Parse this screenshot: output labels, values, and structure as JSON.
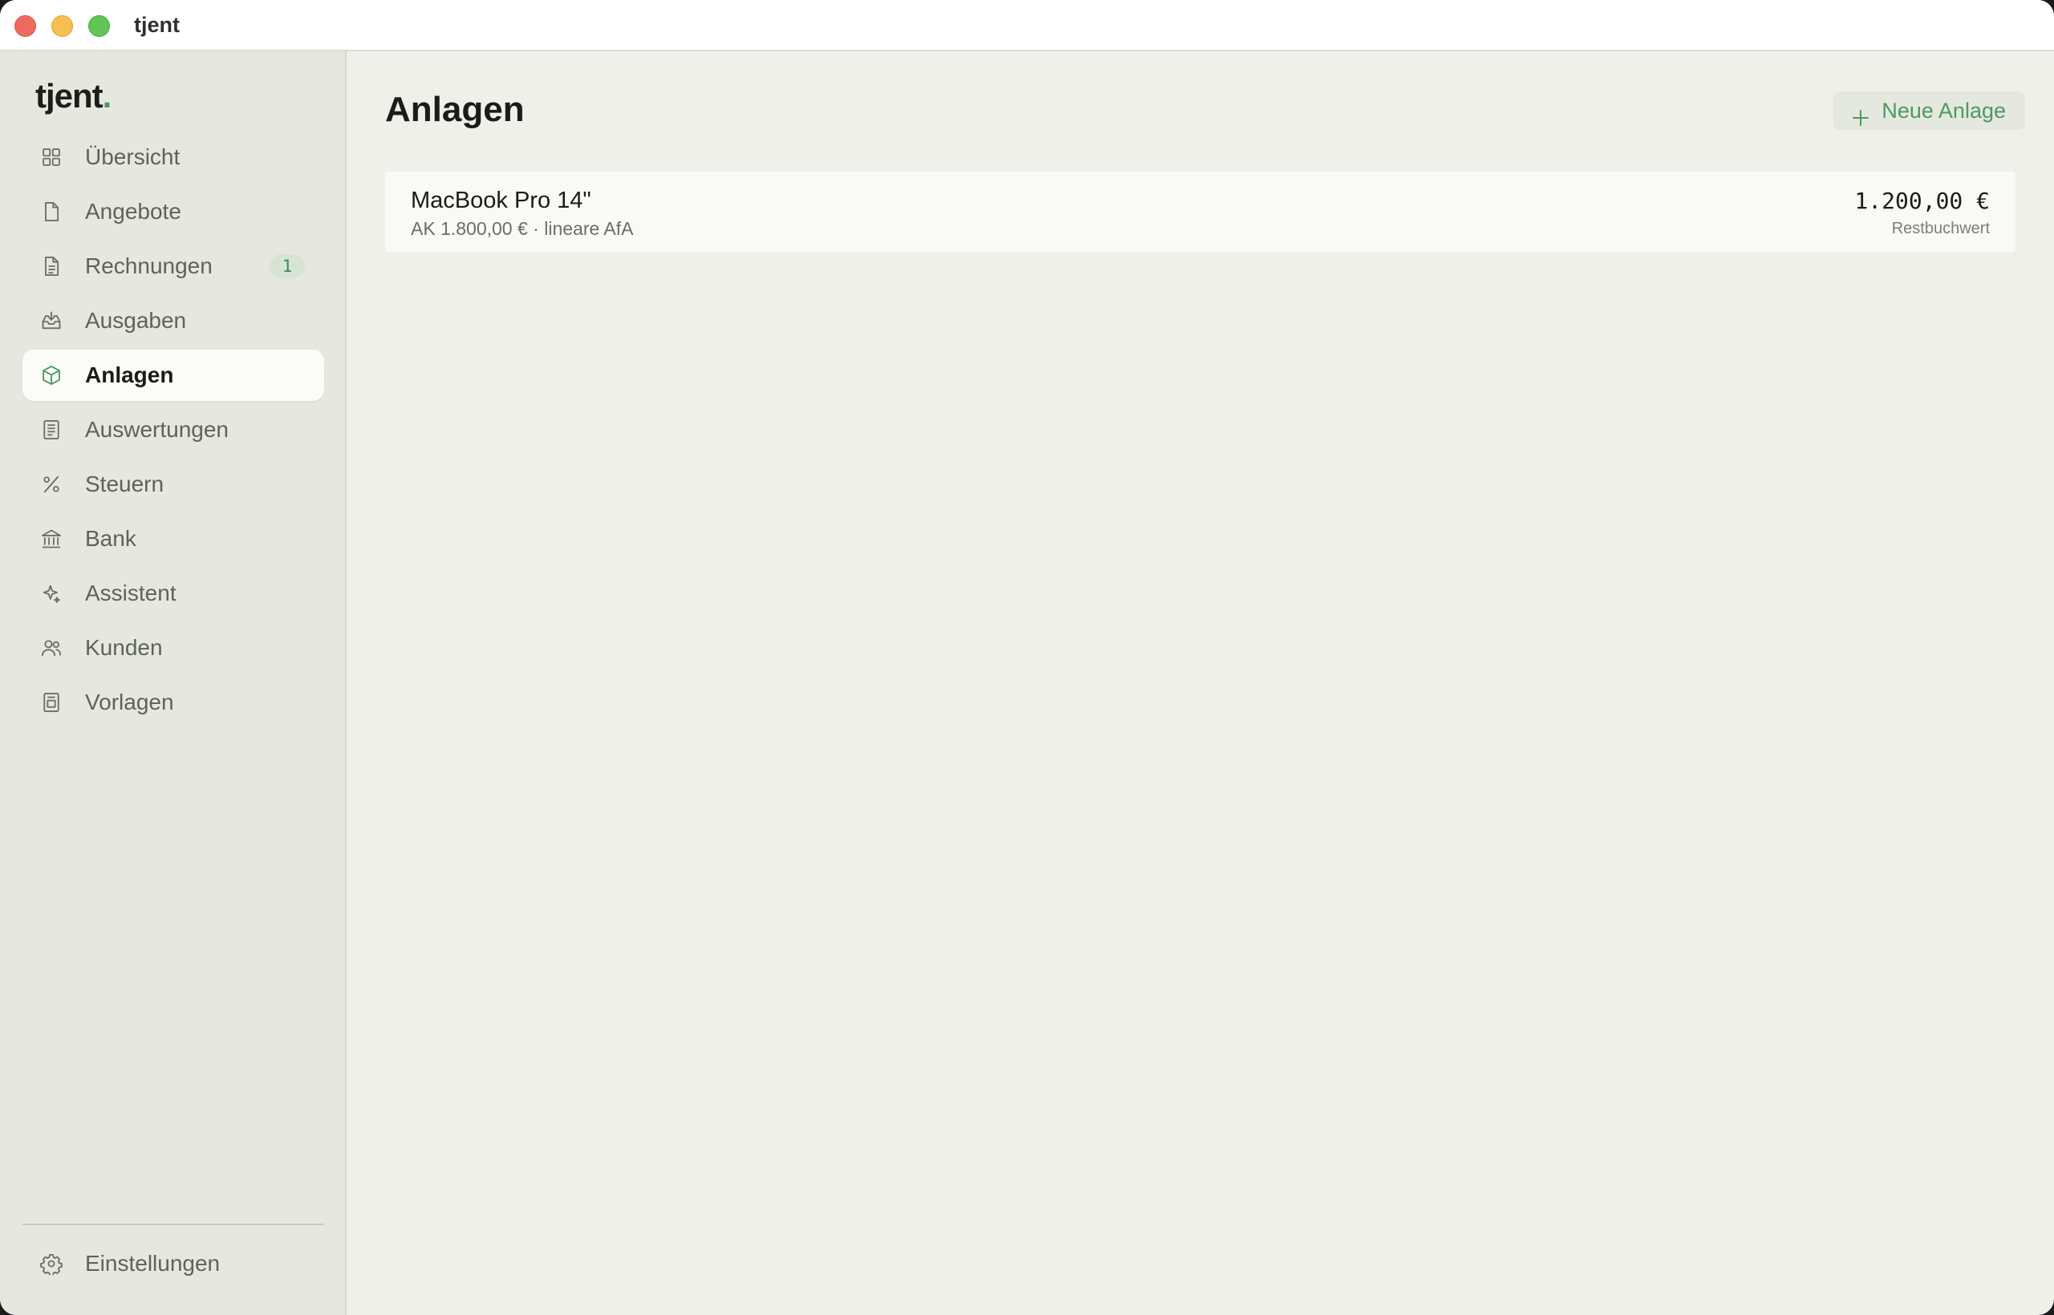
{
  "window": {
    "title": "tjent"
  },
  "sidebar": {
    "logo_text": "tjent",
    "logo_dot": ".",
    "accent_color": "#4c9a5e",
    "items": [
      {
        "label": "Übersicht",
        "icon": "grid-icon",
        "active": false
      },
      {
        "label": "Angebote",
        "icon": "file-icon",
        "active": false
      },
      {
        "label": "Rechnungen",
        "icon": "file-text-icon",
        "active": false,
        "badge": "1"
      },
      {
        "label": "Ausgaben",
        "icon": "inbox-download-icon",
        "active": false
      },
      {
        "label": "Anlagen",
        "icon": "box-icon",
        "active": true
      },
      {
        "label": "Auswertungen",
        "icon": "report-icon",
        "active": false
      },
      {
        "label": "Steuern",
        "icon": "percent-icon",
        "active": false
      },
      {
        "label": "Bank",
        "icon": "bank-icon",
        "active": false
      },
      {
        "label": "Assistent",
        "icon": "sparkle-icon",
        "active": false
      },
      {
        "label": "Kunden",
        "icon": "users-icon",
        "active": false
      },
      {
        "label": "Vorlagen",
        "icon": "template-icon",
        "active": false
      }
    ],
    "settings": {
      "label": "Einstellungen",
      "icon": "gear-icon"
    }
  },
  "main": {
    "title": "Anlagen",
    "new_button_label": "Neue Anlage",
    "assets": [
      {
        "name": "MacBook Pro 14\"",
        "subtitle": "AK 1.800,00 € · lineare AfA",
        "value": "1.200,00 €",
        "value_label": "Restbuchwert"
      }
    ]
  }
}
